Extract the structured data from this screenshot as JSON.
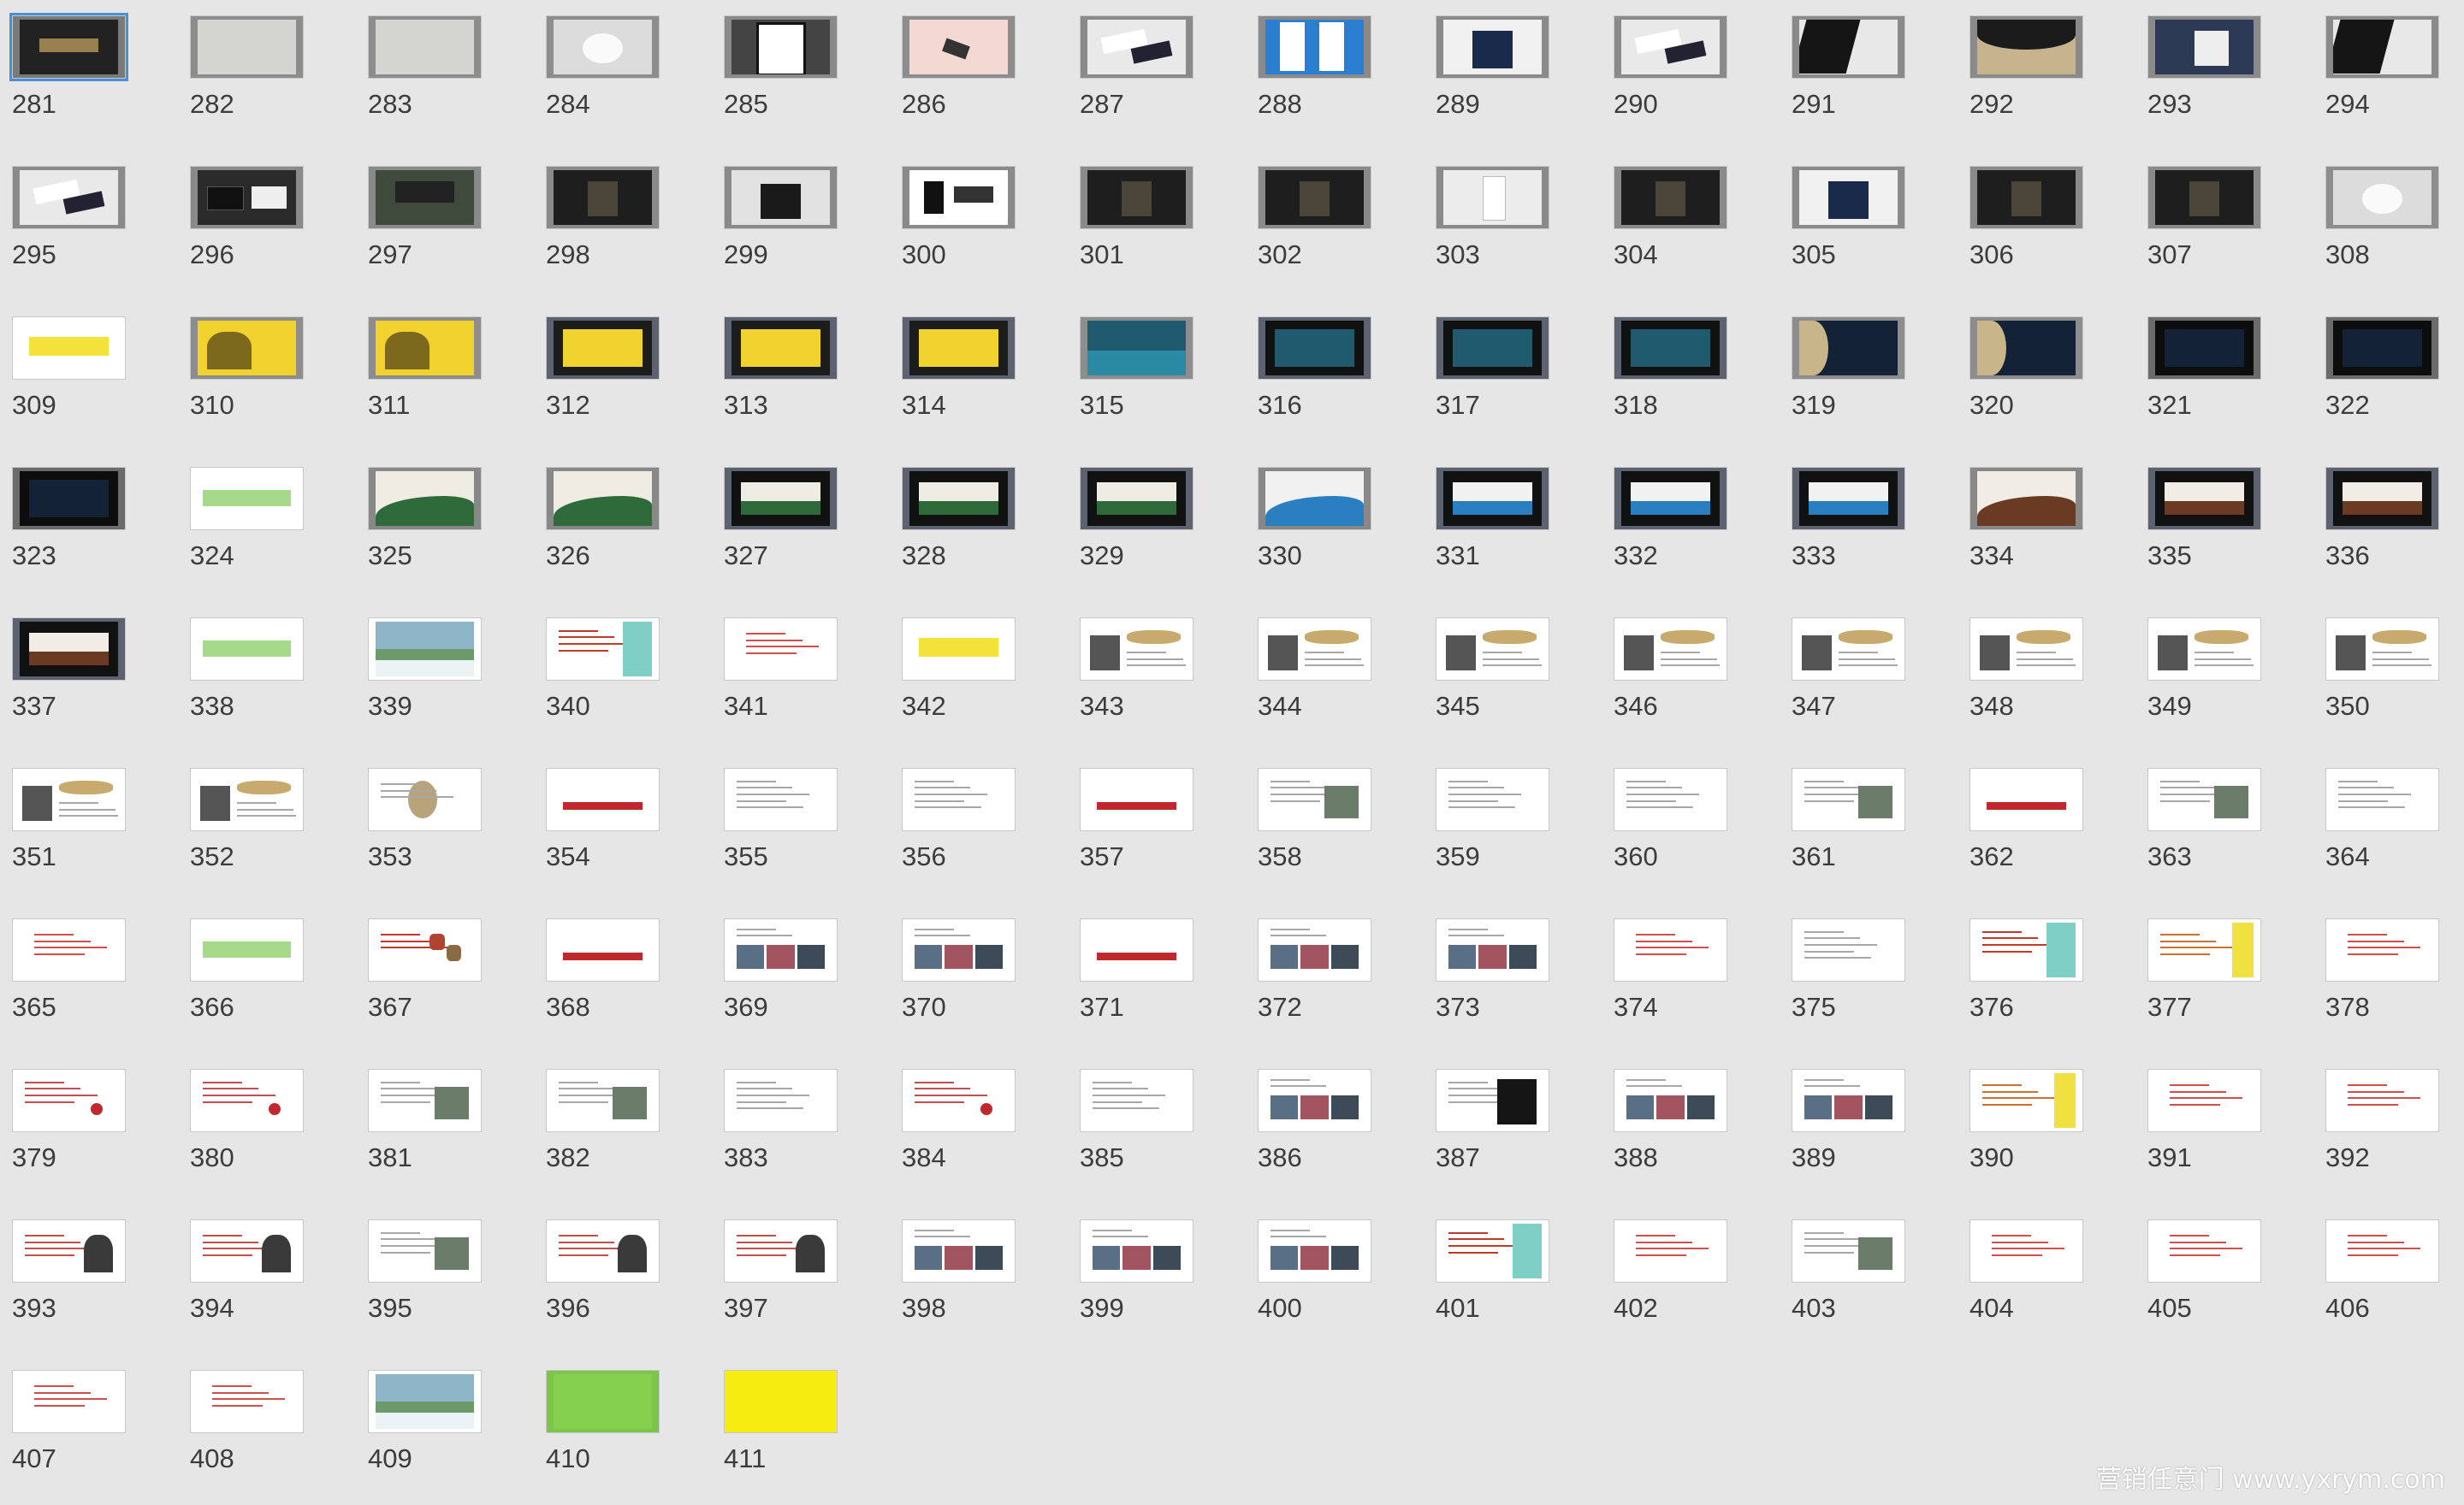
{
  "colors": {
    "background": "#e6e6e6",
    "label": "#3c3c3c",
    "selection": "#4a90d9"
  },
  "watermark": "营销任意门 www.yxrym.com",
  "slides": [
    {
      "n": "281",
      "s": "darklogo"
    },
    {
      "n": "282",
      "s": "paper"
    },
    {
      "n": "283",
      "s": "paper"
    },
    {
      "n": "284",
      "s": "cup"
    },
    {
      "n": "285",
      "s": "tablet"
    },
    {
      "n": "286",
      "s": "pink"
    },
    {
      "n": "287",
      "s": "cards"
    },
    {
      "n": "288",
      "s": "banner"
    },
    {
      "n": "289",
      "s": "bag"
    },
    {
      "n": "290",
      "s": "cards"
    },
    {
      "n": "291",
      "s": "darkwhite"
    },
    {
      "n": "292",
      "s": "umbrella"
    },
    {
      "n": "293",
      "s": "hand"
    },
    {
      "n": "294",
      "s": "darkwhite"
    },
    {
      "n": "295",
      "s": "cards"
    },
    {
      "n": "296",
      "s": "darkcard"
    },
    {
      "n": "297",
      "s": "sign"
    },
    {
      "n": "298",
      "s": "darkobj"
    },
    {
      "n": "299",
      "s": "bagdark"
    },
    {
      "n": "300",
      "s": "whiteset"
    },
    {
      "n": "301",
      "s": "darkobj"
    },
    {
      "n": "302",
      "s": "darkobj"
    },
    {
      "n": "303",
      "s": "whiteobj"
    },
    {
      "n": "304",
      "s": "darkobj"
    },
    {
      "n": "305",
      "s": "bag"
    },
    {
      "n": "306",
      "s": "darkobj"
    },
    {
      "n": "307",
      "s": "darkobj"
    },
    {
      "n": "308",
      "s": "cup"
    },
    {
      "n": "309",
      "s": "yellowbar"
    },
    {
      "n": "310",
      "s": "yellow"
    },
    {
      "n": "311",
      "s": "yellow"
    },
    {
      "n": "312",
      "s": "yellowbb"
    },
    {
      "n": "313",
      "s": "yellowbb"
    },
    {
      "n": "314",
      "s": "yellowbb"
    },
    {
      "n": "315",
      "s": "teal"
    },
    {
      "n": "316",
      "s": "tealbb"
    },
    {
      "n": "317",
      "s": "tealbb"
    },
    {
      "n": "318",
      "s": "tealbb"
    },
    {
      "n": "319",
      "s": "navy"
    },
    {
      "n": "320",
      "s": "navy"
    },
    {
      "n": "321",
      "s": "navybb"
    },
    {
      "n": "322",
      "s": "navybb"
    },
    {
      "n": "323",
      "s": "navybb"
    },
    {
      "n": "324",
      "s": "greenbar"
    },
    {
      "n": "325",
      "s": "greenwave"
    },
    {
      "n": "326",
      "s": "greenwave"
    },
    {
      "n": "327",
      "s": "greenbb"
    },
    {
      "n": "328",
      "s": "greenbb"
    },
    {
      "n": "329",
      "s": "greenbb"
    },
    {
      "n": "330",
      "s": "bluewave"
    },
    {
      "n": "331",
      "s": "bluebb"
    },
    {
      "n": "332",
      "s": "bluebb"
    },
    {
      "n": "333",
      "s": "bluebb"
    },
    {
      "n": "334",
      "s": "brownwave"
    },
    {
      "n": "335",
      "s": "brownbb"
    },
    {
      "n": "336",
      "s": "brownbb"
    },
    {
      "n": "337",
      "s": "brownbb"
    },
    {
      "n": "338",
      "s": "greenbar"
    },
    {
      "n": "339",
      "s": "landscape"
    },
    {
      "n": "340",
      "s": "textcyan"
    },
    {
      "n": "341",
      "s": "textred"
    },
    {
      "n": "342",
      "s": "yellowbar"
    },
    {
      "n": "343",
      "s": "quote"
    },
    {
      "n": "344",
      "s": "quote"
    },
    {
      "n": "345",
      "s": "quote"
    },
    {
      "n": "346",
      "s": "quote"
    },
    {
      "n": "347",
      "s": "quote"
    },
    {
      "n": "348",
      "s": "quote"
    },
    {
      "n": "349",
      "s": "quote"
    },
    {
      "n": "350",
      "s": "quote"
    },
    {
      "n": "351",
      "s": "quote"
    },
    {
      "n": "352",
      "s": "quote"
    },
    {
      "n": "353",
      "s": "circle"
    },
    {
      "n": "354",
      "s": "redbar"
    },
    {
      "n": "355",
      "s": "text"
    },
    {
      "n": "356",
      "s": "text"
    },
    {
      "n": "357",
      "s": "redbar"
    },
    {
      "n": "358",
      "s": "textimg"
    },
    {
      "n": "359",
      "s": "text"
    },
    {
      "n": "360",
      "s": "text"
    },
    {
      "n": "361",
      "s": "textimg"
    },
    {
      "n": "362",
      "s": "redbar"
    },
    {
      "n": "363",
      "s": "textimg"
    },
    {
      "n": "364",
      "s": "text"
    },
    {
      "n": "365",
      "s": "textred"
    },
    {
      "n": "366",
      "s": "greenbar"
    },
    {
      "n": "367",
      "s": "hexes"
    },
    {
      "n": "368",
      "s": "redbar"
    },
    {
      "n": "369",
      "s": "photos"
    },
    {
      "n": "370",
      "s": "photos"
    },
    {
      "n": "371",
      "s": "redbar"
    },
    {
      "n": "372",
      "s": "photos"
    },
    {
      "n": "373",
      "s": "photos"
    },
    {
      "n": "374",
      "s": "textred"
    },
    {
      "n": "375",
      "s": "text"
    },
    {
      "n": "376",
      "s": "textcyan"
    },
    {
      "n": "377",
      "s": "textyellow"
    },
    {
      "n": "378",
      "s": "textred"
    },
    {
      "n": "379",
      "s": "reddot"
    },
    {
      "n": "380",
      "s": "reddot"
    },
    {
      "n": "381",
      "s": "textimg"
    },
    {
      "n": "382",
      "s": "textimg"
    },
    {
      "n": "383",
      "s": "text"
    },
    {
      "n": "384",
      "s": "reddot"
    },
    {
      "n": "385",
      "s": "text"
    },
    {
      "n": "386",
      "s": "photos"
    },
    {
      "n": "387",
      "s": "darkimg"
    },
    {
      "n": "388",
      "s": "photos"
    },
    {
      "n": "389",
      "s": "photos"
    },
    {
      "n": "390",
      "s": "textyellow"
    },
    {
      "n": "391",
      "s": "textred"
    },
    {
      "n": "392",
      "s": "textred"
    },
    {
      "n": "393",
      "s": "people"
    },
    {
      "n": "394",
      "s": "people"
    },
    {
      "n": "395",
      "s": "textimg"
    },
    {
      "n": "396",
      "s": "people"
    },
    {
      "n": "397",
      "s": "people"
    },
    {
      "n": "398",
      "s": "photos"
    },
    {
      "n": "399",
      "s": "photos"
    },
    {
      "n": "400",
      "s": "photos"
    },
    {
      "n": "401",
      "s": "textcyan"
    },
    {
      "n": "402",
      "s": "textred"
    },
    {
      "n": "403",
      "s": "textimg"
    },
    {
      "n": "404",
      "s": "textred"
    },
    {
      "n": "405",
      "s": "textred"
    },
    {
      "n": "406",
      "s": "textred"
    },
    {
      "n": "407",
      "s": "textred"
    },
    {
      "n": "408",
      "s": "textred"
    },
    {
      "n": "409",
      "s": "landscape"
    },
    {
      "n": "410",
      "s": "green"
    },
    {
      "n": "411",
      "s": "yellowfull"
    }
  ]
}
